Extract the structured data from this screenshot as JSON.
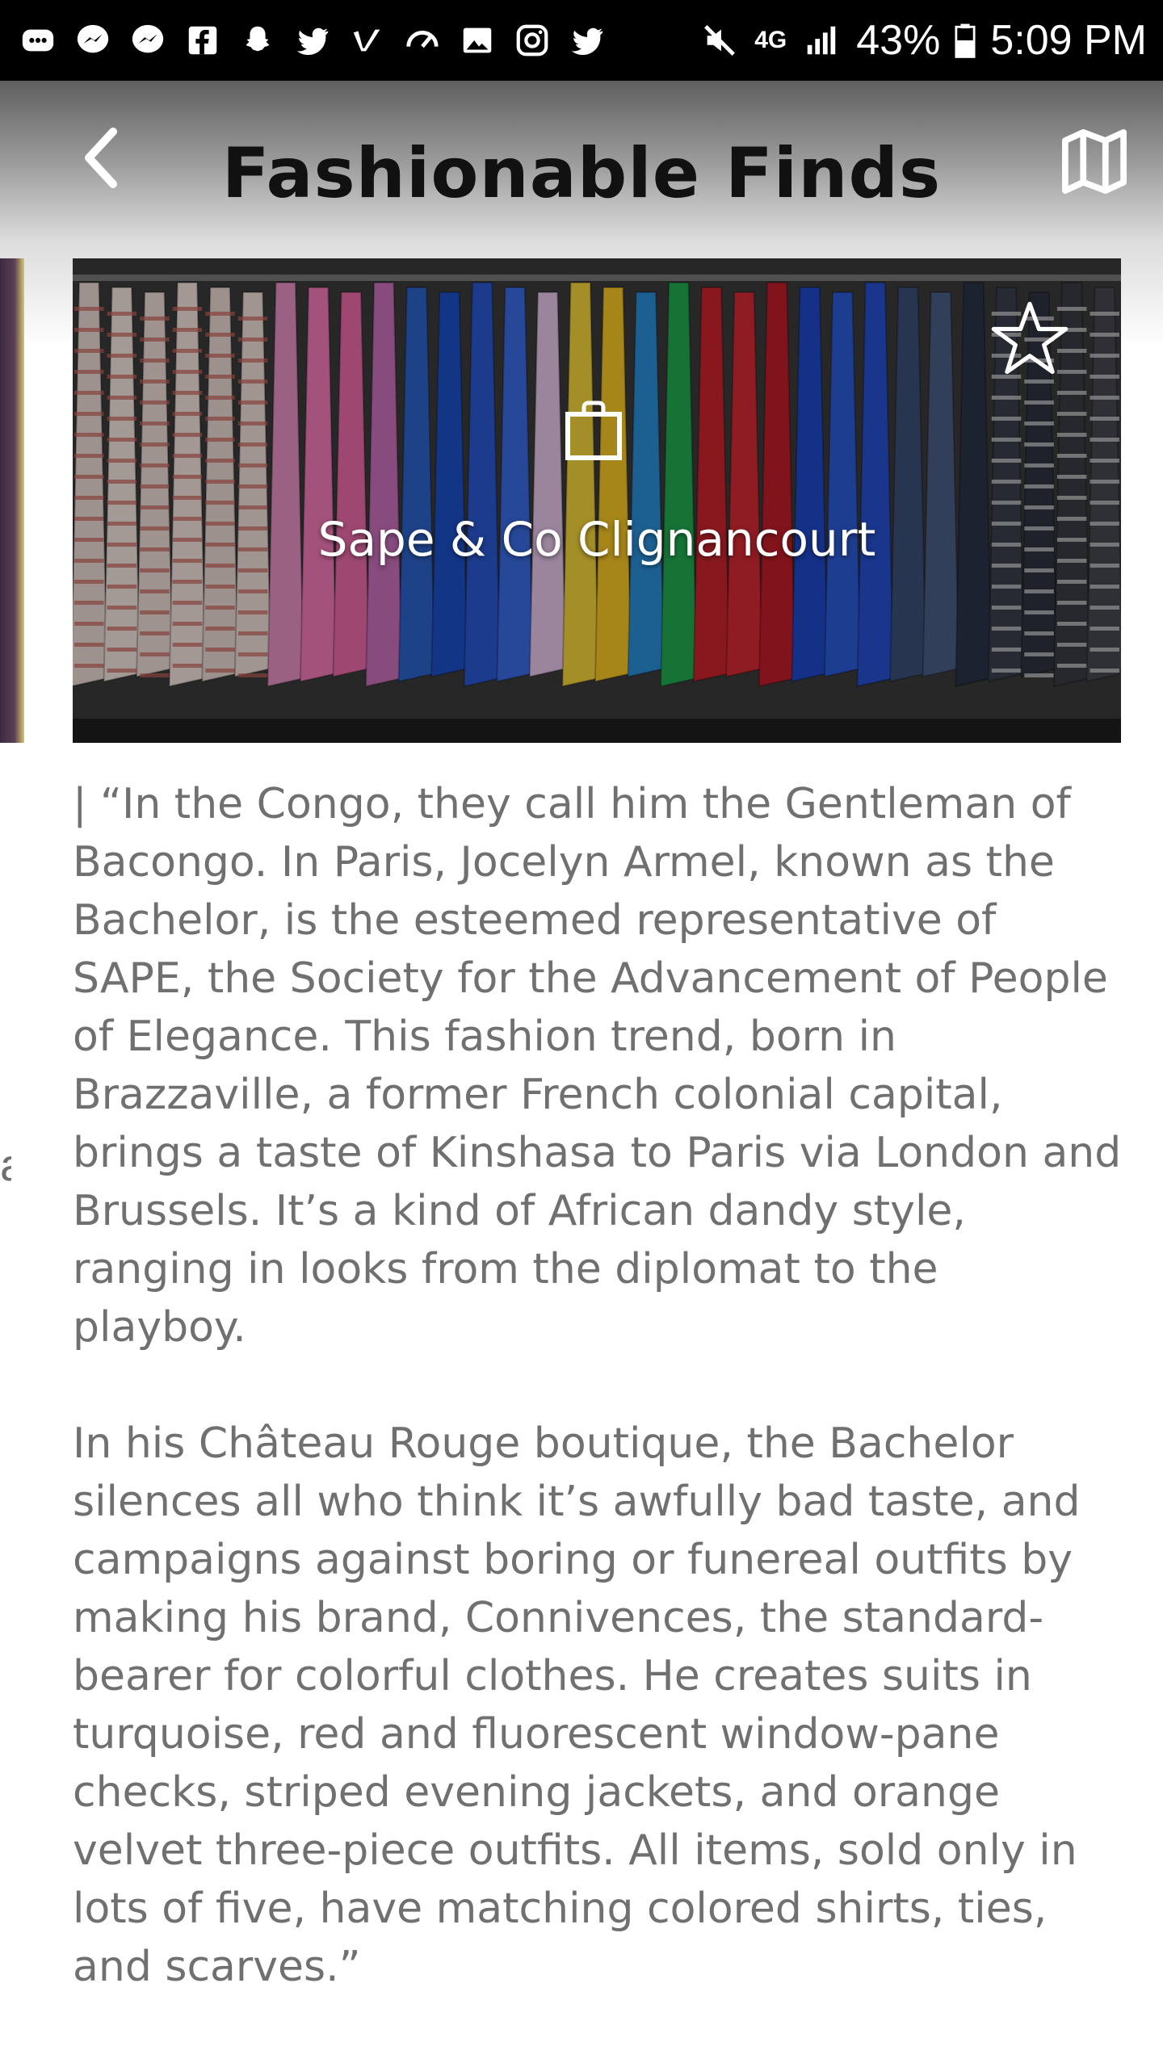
{
  "status_bar": {
    "notification_icons": [
      "messages-icon",
      "messenger-icon",
      "messenger-icon",
      "facebook-icon",
      "snapchat-icon",
      "twitter-icon",
      "vimeo-icon",
      "speedometer-icon",
      "gallery-icon",
      "instagram-icon",
      "twitter-icon"
    ],
    "network": "4G",
    "battery": "43%",
    "time": "5:09 PM"
  },
  "header": {
    "title": "Fashionable Finds",
    "back_icon": "chevron-left-icon",
    "map_icon": "map-icon"
  },
  "card": {
    "name": "Sape & Co Clignancourt",
    "category_icon": "shopping-bag-icon",
    "favorite_icon": "star-outline-icon"
  },
  "description": {
    "paragraph_1": " | “In the Congo, they call him the Gentleman of Bacongo. In Paris, Jocelyn Armel, known as the Bachelor, is the esteemed representative of SAPE, the Society for the Advancement of People of Elegance. This fashion trend, born in Brazzaville, a former French colonial capital, brings a taste of Kinshasa to Paris via London and Brussels. It’s a kind of African dandy style, ranging in looks from the diplomat to the playboy.",
    "paragraph_2": "In his Château Rouge boutique, the Bachelor silences all who think it’s awfully bad taste, and campaigns against boring or funereal outfits by making his brand, Connivences, the standard-bearer for colorful clothes. He creates suits in turquoise, red and fluorescent window-pane checks, striped evening jackets, and orange velvet three-piece outfits. All items, sold only in lots of five, have matching colored shirts, ties, and scarves.”"
  },
  "peek": {
    "text": "a"
  }
}
